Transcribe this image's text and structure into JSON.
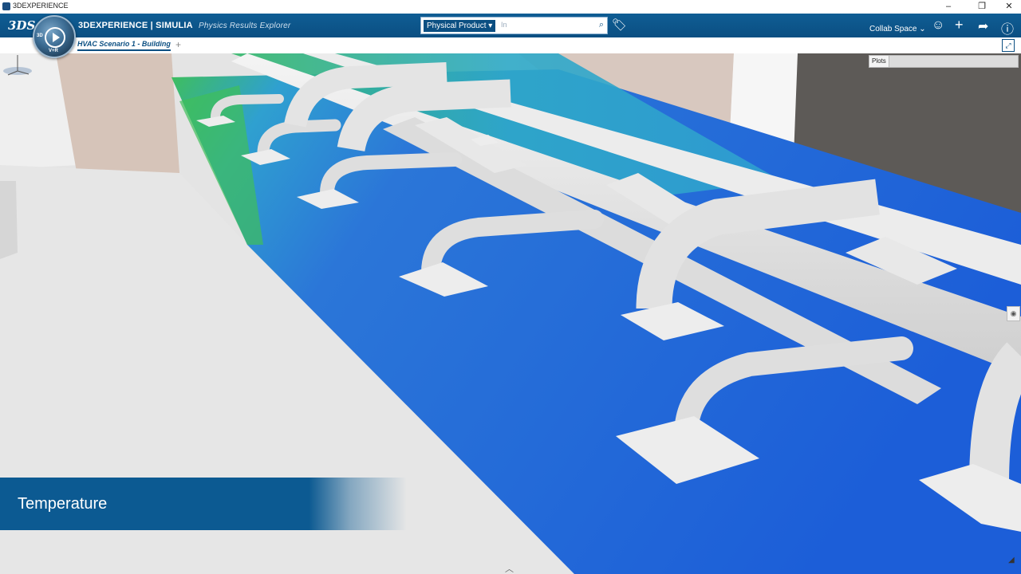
{
  "window": {
    "title": "3DEXPERIENCE",
    "controls": [
      "–",
      "❐",
      "✕"
    ]
  },
  "header": {
    "logo": "3DS",
    "compass_labels": [
      "3D",
      "V+R"
    ],
    "brand": "3DEXPERIENCE | SIMULIA",
    "app_name": "Physics Results Explorer",
    "search": {
      "scope": "Physical Product",
      "placeholder": "In"
    },
    "collab_space": "Collab Space",
    "icons": [
      "user-icon",
      "add-icon",
      "share-icon",
      "help-icon"
    ]
  },
  "tabs": [
    {
      "label": "HVAC Scenario 1 - Building"
    }
  ],
  "viewport": {
    "plots_label": "Plots",
    "banner_text": "Temperature",
    "colors": {
      "cold": "#1d5fd6",
      "mid": "#2fa0d0",
      "warm": "#3fbf5a",
      "duct": "#e6e6e6",
      "banner": "#0c5a92"
    }
  }
}
